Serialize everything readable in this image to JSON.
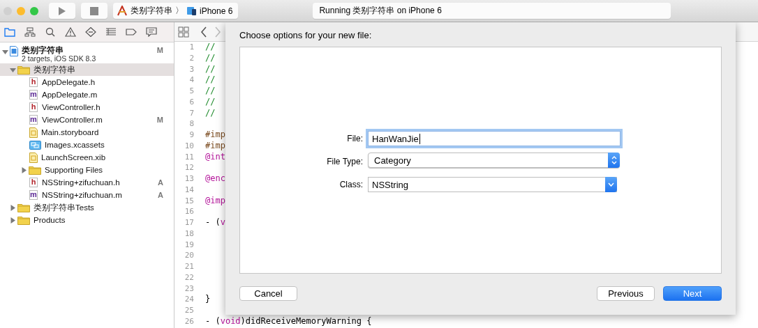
{
  "window": {
    "activity": "Running 类别字符串 on iPhone 6"
  },
  "toolbar": {
    "scheme": "类别字符串",
    "separator": "〉",
    "device": "iPhone 6"
  },
  "nav_tabs": [
    {
      "kind": "folder",
      "selected": true
    },
    {
      "kind": "hierarchy",
      "selected": false
    },
    {
      "kind": "search",
      "selected": false
    },
    {
      "kind": "warning",
      "selected": false
    },
    {
      "kind": "test",
      "selected": false
    },
    {
      "kind": "list",
      "selected": false
    },
    {
      "kind": "tag",
      "selected": false
    },
    {
      "kind": "chat",
      "selected": false
    }
  ],
  "tree": [
    {
      "kind": "project",
      "name": "类别字符串",
      "subtitle": "2 targets, iOS SDK 8.3",
      "badge": "M",
      "expanded": true,
      "selected": false,
      "children": [
        {
          "kind": "folder",
          "name": "类别字符串",
          "expanded": true,
          "selected": true,
          "children": [
            {
              "kind": "source",
              "letter": "h",
              "name": "AppDelegate.h",
              "selected": false
            },
            {
              "kind": "source",
              "letter": "m",
              "name": "AppDelegate.m",
              "selected": false
            },
            {
              "kind": "source",
              "letter": "h",
              "name": "ViewController.h",
              "selected": false
            },
            {
              "kind": "source",
              "letter": "m",
              "name": "ViewController.m",
              "badge": "M",
              "selected": false
            },
            {
              "kind": "storyboard",
              "name": "Main.storyboard",
              "selected": false
            },
            {
              "kind": "assets",
              "name": "Images.xcassets",
              "selected": false
            },
            {
              "kind": "storyboard",
              "name": "LaunchScreen.xib",
              "selected": false
            },
            {
              "kind": "folder",
              "name": "Supporting Files",
              "expanded": false,
              "selected": false
            },
            {
              "kind": "source",
              "letter": "h",
              "name": "NSString+zifuchuan.h",
              "badge": "A",
              "selected": false
            },
            {
              "kind": "source",
              "letter": "m",
              "name": "NSString+zifuchuan.m",
              "badge": "A",
              "selected": false
            }
          ]
        },
        {
          "kind": "folder",
          "name": "类别字符串Tests",
          "expanded": false,
          "selected": false
        },
        {
          "kind": "folder",
          "name": "Products",
          "expanded": false,
          "selected": false
        }
      ]
    }
  ],
  "jump_bar": [
    {
      "kind": "back",
      "disabled": false
    },
    {
      "kind": "forward",
      "disabled": true
    }
  ],
  "code": [
    {
      "number": "1",
      "tokens": [
        {
          "text": "//",
          "kind": "comment"
        }
      ]
    },
    {
      "number": "2",
      "tokens": [
        {
          "text": "//",
          "kind": "comment"
        }
      ]
    },
    {
      "number": "3",
      "tokens": [
        {
          "text": "//",
          "kind": "comment"
        }
      ]
    },
    {
      "number": "4",
      "tokens": [
        {
          "text": "//",
          "kind": "comment"
        }
      ]
    },
    {
      "number": "5",
      "tokens": [
        {
          "text": "//",
          "kind": "comment"
        }
      ]
    },
    {
      "number": "6",
      "tokens": [
        {
          "text": "//",
          "kind": "comment"
        }
      ]
    },
    {
      "number": "7",
      "tokens": [
        {
          "text": "//",
          "kind": "comment"
        }
      ]
    },
    {
      "number": "8"
    },
    {
      "number": "9",
      "tokens": [
        {
          "text": "#imp",
          "kind": "preprocessor"
        }
      ]
    },
    {
      "number": "10",
      "tokens": [
        {
          "text": "#imp",
          "kind": "preprocessor"
        }
      ]
    },
    {
      "number": "11",
      "tokens": [
        {
          "text": "@int",
          "kind": "keyword"
        }
      ]
    },
    {
      "number": "12"
    },
    {
      "number": "13",
      "tokens": [
        {
          "text": "@enc",
          "kind": "keyword"
        }
      ]
    },
    {
      "number": "14"
    },
    {
      "number": "15",
      "tokens": [
        {
          "text": "@imp",
          "kind": "keyword"
        }
      ]
    },
    {
      "number": "16"
    },
    {
      "number": "17",
      "tokens": [
        {
          "text": "- (",
          "kind": "plain"
        },
        {
          "text": "v",
          "kind": "keyword"
        }
      ]
    },
    {
      "number": "18"
    },
    {
      "number": "19"
    },
    {
      "number": "20"
    },
    {
      "number": "21"
    },
    {
      "number": "22"
    },
    {
      "number": "23"
    },
    {
      "number": "24",
      "tokens": [
        {
          "text": "}",
          "kind": "plain"
        }
      ]
    },
    {
      "number": "25"
    },
    {
      "number": "26",
      "tokens": [
        {
          "text": "- (",
          "kind": "plain"
        },
        {
          "text": "void",
          "kind": "keyword"
        },
        {
          "text": ")didReceiveMemoryWarning {",
          "kind": "plain"
        }
      ]
    }
  ],
  "sheet": {
    "title": "Choose options for your new file:",
    "fields": [
      {
        "label": "File:",
        "kind": "text",
        "value": "HanWanJie",
        "focused": true
      },
      {
        "label": "File Type:",
        "kind": "popup",
        "value": "Category",
        "focused": false
      },
      {
        "label": "Class:",
        "kind": "combo",
        "value": "NSString",
        "focused": false
      }
    ],
    "buttons": [
      {
        "label": "Cancel",
        "default": false
      },
      {
        "label": "Previous",
        "default": false
      },
      {
        "label": "Next",
        "default": true
      }
    ]
  }
}
